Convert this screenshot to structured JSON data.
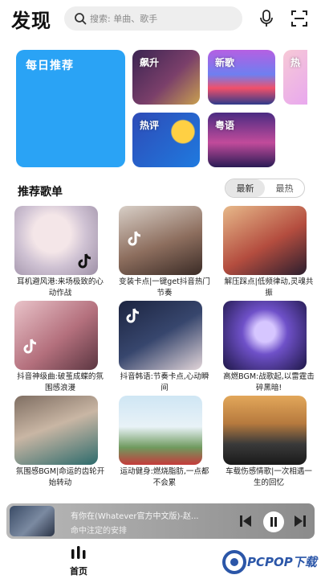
{
  "header": {
    "title": "发现",
    "search_placeholder": "搜索: 单曲、歌手"
  },
  "categories": {
    "daily": "每日推荐",
    "tiles": [
      "飙升",
      "新歌",
      "热",
      "热评",
      "粤语"
    ]
  },
  "playlists": {
    "title": "推荐歌单",
    "sort_options": [
      "最新",
      "最热"
    ],
    "selected_sort": "最新",
    "items": [
      {
        "caption": "耳机避风港:来场极致的心动作战"
      },
      {
        "caption": "变装卡点|一键get抖音热门节奏"
      },
      {
        "caption": "解压踩点|低频律动,灵魂共振"
      },
      {
        "caption": "抖音神级曲:破茧成蝶的氛围感浪漫"
      },
      {
        "caption": "抖音韩语:节奏卡点,心动瞬间"
      },
      {
        "caption": "高燃BGM:战歌起,以雷霆击碎黑暗!"
      },
      {
        "caption": "氛围感BGM|命运的齿轮开始转动"
      },
      {
        "caption": "运动健身:燃烧脂肪,一点都不会累"
      },
      {
        "caption": "车载伤感情歌|一次相遇一生的回忆"
      }
    ]
  },
  "player": {
    "song": "有你在(Whatever官方中文版)-赵...",
    "lyric": "命中注定的安排",
    "progress": 0.0
  },
  "nav": {
    "home_label": "首页"
  },
  "watermark": "PCPOP下载",
  "colors": {
    "daily": "#2aa3f5",
    "accent": "#2b56a8"
  }
}
